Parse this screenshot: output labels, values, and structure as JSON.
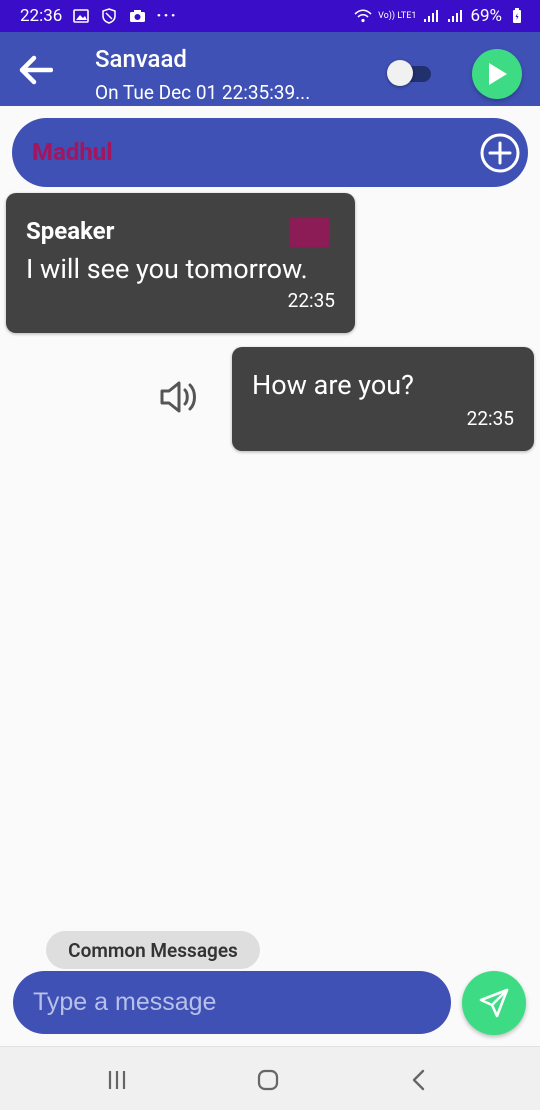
{
  "status_bar": {
    "time": "22:36",
    "battery": "69%",
    "network_label": "Vo)) LTE1",
    "left_icons": [
      "gallery-icon",
      "shield-icon",
      "camera-icon",
      "more-dots-icon"
    ],
    "right_icons": [
      "wifi-icon",
      "signal-icon",
      "signal-icon",
      "battery-icon"
    ]
  },
  "app_bar": {
    "title": "Sanvaad",
    "subtitle": "On Tue Dec 01 22:35:39...",
    "accent": "#3f51b5",
    "play_color": "#3ddc84"
  },
  "partner": {
    "name": "Madhul",
    "name_color": "#a3165e"
  },
  "messages": [
    {
      "sender": "Speaker",
      "text": "I will see you tomorrow.",
      "time": "22:35",
      "swatch_color": "#8b1c55"
    },
    {
      "text": "How are you?",
      "time": "22:35"
    }
  ],
  "composer": {
    "common_messages_label": "Common Messages",
    "placeholder": "Type a message"
  }
}
